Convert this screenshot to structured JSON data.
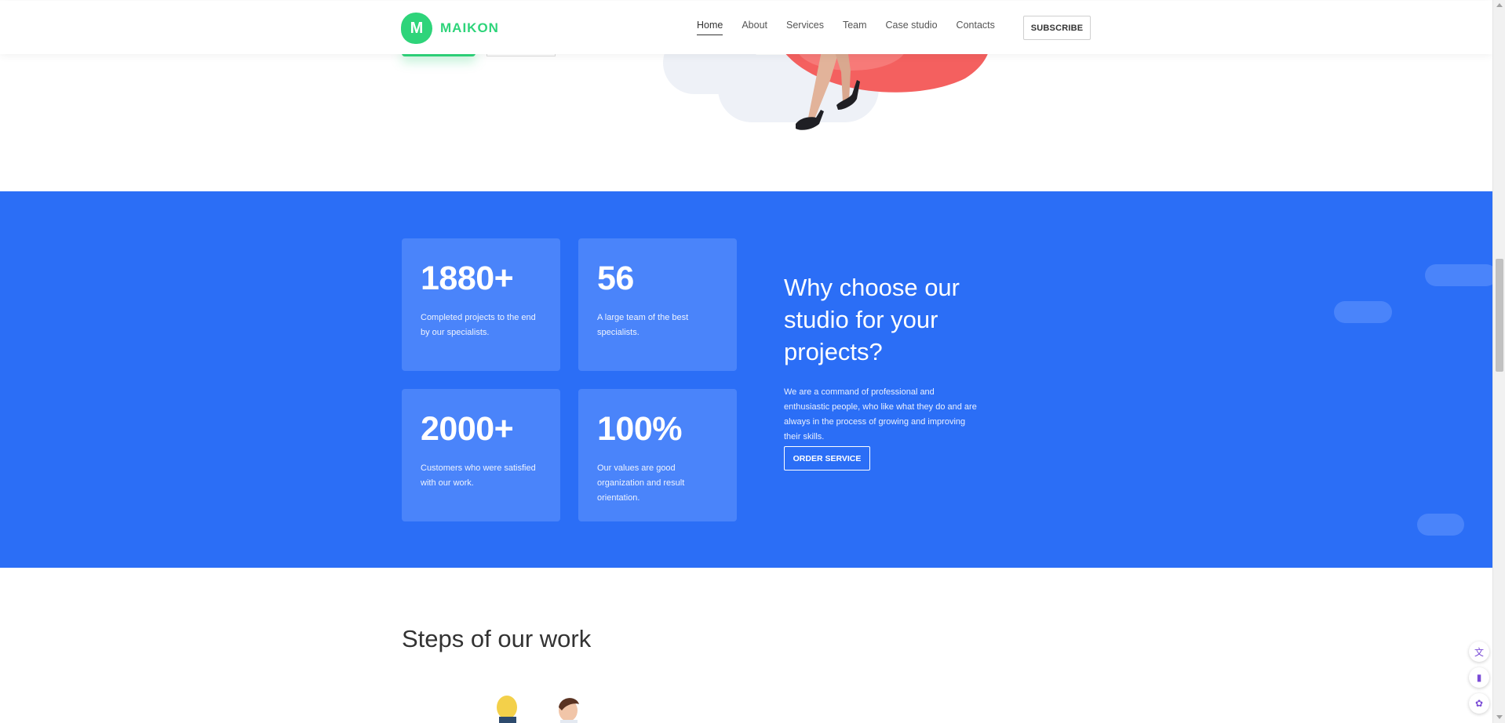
{
  "brand": {
    "logo_letter": "M",
    "name": "MAIKON",
    "color": "#2ed47a"
  },
  "nav": {
    "items": [
      {
        "label": "Home",
        "active": true
      },
      {
        "label": "About"
      },
      {
        "label": "Services"
      },
      {
        "label": "Team"
      },
      {
        "label": "Case studio"
      },
      {
        "label": "Contacts"
      }
    ],
    "subscribe_label": "SUBSCRIBE"
  },
  "stats": {
    "background": "#2b6ef6",
    "cards": [
      {
        "number": "1880+",
        "text": "Completed projects to the end by our specialists."
      },
      {
        "number": "56",
        "text": "A large team of the best specialists."
      },
      {
        "number": "2000+",
        "text": "Customers who were satisfied with our work."
      },
      {
        "number": "100%",
        "text": "Our values are good organization and result orientation."
      }
    ],
    "heading": "Why choose our studio for your projects?",
    "paragraph": "We are a command of professional and enthusiastic people, who like what they do and are always in the process of growing and improving their skills.",
    "order_label": "ORDER SERVICE"
  },
  "steps": {
    "title": "Steps of our work"
  },
  "side_tools": [
    {
      "icon": "translate-icon",
      "glyph": "文"
    },
    {
      "icon": "book-icon",
      "glyph": "▮"
    },
    {
      "icon": "brain-icon",
      "glyph": "✿"
    }
  ]
}
